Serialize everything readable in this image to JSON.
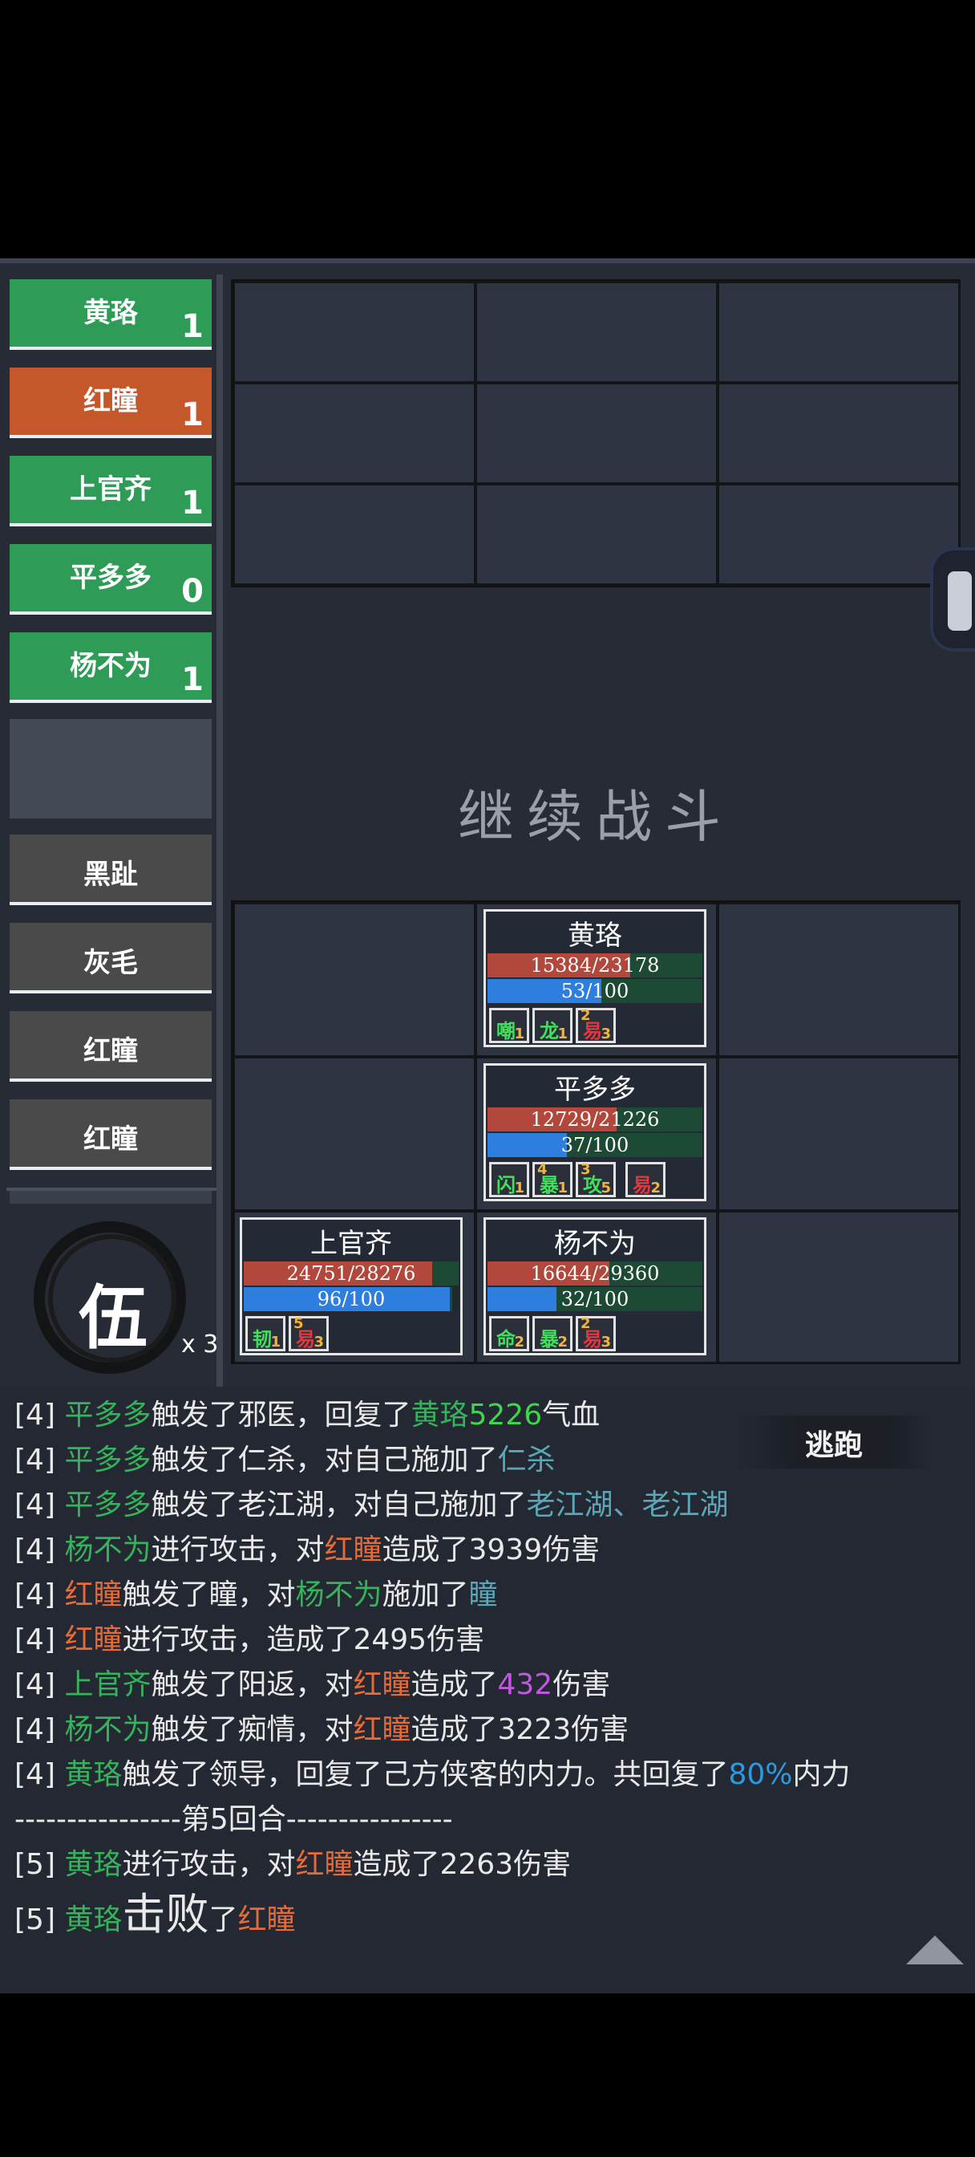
{
  "allies": [
    {
      "name": "黄珞",
      "count": "1",
      "active": false
    },
    {
      "name": "红瞳",
      "count": "1",
      "active": true
    },
    {
      "name": "上官齐",
      "count": "1",
      "active": false
    },
    {
      "name": "平多多",
      "count": "0",
      "active": false
    },
    {
      "name": "杨不为",
      "count": "1",
      "active": false
    }
  ],
  "enemies": [
    "黑趾",
    "灰毛",
    "红瞳",
    "红瞳"
  ],
  "formation": {
    "glyph": "伍",
    "multiplier": "x 3"
  },
  "continue_label": "继续战斗",
  "units": [
    {
      "name": "黄珞",
      "hp": "15384/23178",
      "hp_frac": 0.664,
      "mp": "53/100",
      "mp_frac": 0.53,
      "tags": [
        {
          "char": "嘲",
          "sub": "1",
          "color": "green"
        },
        {
          "char": "龙",
          "sub": "1",
          "color": "green"
        },
        {
          "char": "易",
          "sup": "2",
          "sub": "3",
          "color": "red"
        }
      ]
    },
    {
      "name": "平多多",
      "hp": "12729/21226",
      "hp_frac": 0.6,
      "mp": "37/100",
      "mp_frac": 0.37,
      "tags": [
        {
          "char": "闪",
          "sub": "1",
          "color": "green"
        },
        {
          "char": "暴",
          "sup": "4",
          "sub": "1",
          "color": "green"
        },
        {
          "char": "攻",
          "sup": "3",
          "sub": "5",
          "color": "green"
        },
        {
          "char": "易",
          "sub": "2",
          "color": "red"
        }
      ]
    },
    {
      "name": "上官齐",
      "hp": "24751/28276",
      "hp_frac": 0.875,
      "mp": "96/100",
      "mp_frac": 0.96,
      "tags": [
        {
          "char": "韧",
          "sub": "1",
          "color": "green"
        },
        {
          "char": "易",
          "sup": "5",
          "sub": "3",
          "color": "red"
        }
      ]
    },
    {
      "name": "杨不为",
      "hp": "16644/29360",
      "hp_frac": 0.567,
      "mp": "32/100",
      "mp_frac": 0.32,
      "tags": [
        {
          "char": "命",
          "sub": "2",
          "color": "green"
        },
        {
          "char": "暴",
          "sub": "2",
          "color": "green"
        },
        {
          "char": "易",
          "sup": "2",
          "sub": "3",
          "color": "red"
        }
      ]
    }
  ],
  "flee_label": "逃跑",
  "log": {
    "l1": {
      "p": "[4] ",
      "a": "平多多",
      "b": "触发了邪医，回复了",
      "c": "黄珞",
      "d": "5226",
      "e": "气血"
    },
    "l2": {
      "p": "[4] ",
      "a": "平多多",
      "b": "触发了仁杀，对自己施加了",
      "c": "仁杀"
    },
    "l3": {
      "p": "[4] ",
      "a": "平多多",
      "b": "触发了老江湖，对自己施加了",
      "c": "老江湖、老江湖"
    },
    "l4": {
      "p": "[4] ",
      "a": "杨不为",
      "b": "进行攻击，对",
      "c": "红瞳",
      "d": "造成了3939伤害"
    },
    "l5": {
      "p": "[4] ",
      "a": "红瞳",
      "b": "触发了瞳，对",
      "c": "杨不为",
      "d": "施加了",
      "e": "瞳"
    },
    "l6": {
      "p": "[4] ",
      "a": "红瞳",
      "b": "进行攻击，造成了2495伤害"
    },
    "l7": {
      "p": "[4] ",
      "a": "上官齐",
      "b": "触发了阳返，对",
      "c": "红瞳",
      "d": "造成了",
      "e": "432",
      "f": "伤害"
    },
    "l8": {
      "p": "[4] ",
      "a": "杨不为",
      "b": "触发了痴情，对",
      "c": "红瞳",
      "d": "造成了3223伤害"
    },
    "l9": {
      "p": "[4] ",
      "a": "黄珞",
      "b": "触发了领导，回复了己方侠客的内力。共回复了",
      "c": "80%",
      "d": "内力"
    },
    "l10": {
      "text": "----------------第5回合----------------"
    },
    "l11": {
      "p": "[5] ",
      "a": "黄珞",
      "b": "进行攻击，对",
      "c": "红瞳",
      "d": "造成了2263伤害"
    },
    "l12": {
      "p": "[5] ",
      "a": "黄珞",
      "b": "击败",
      "c": "了",
      "d": "红瞳"
    }
  }
}
